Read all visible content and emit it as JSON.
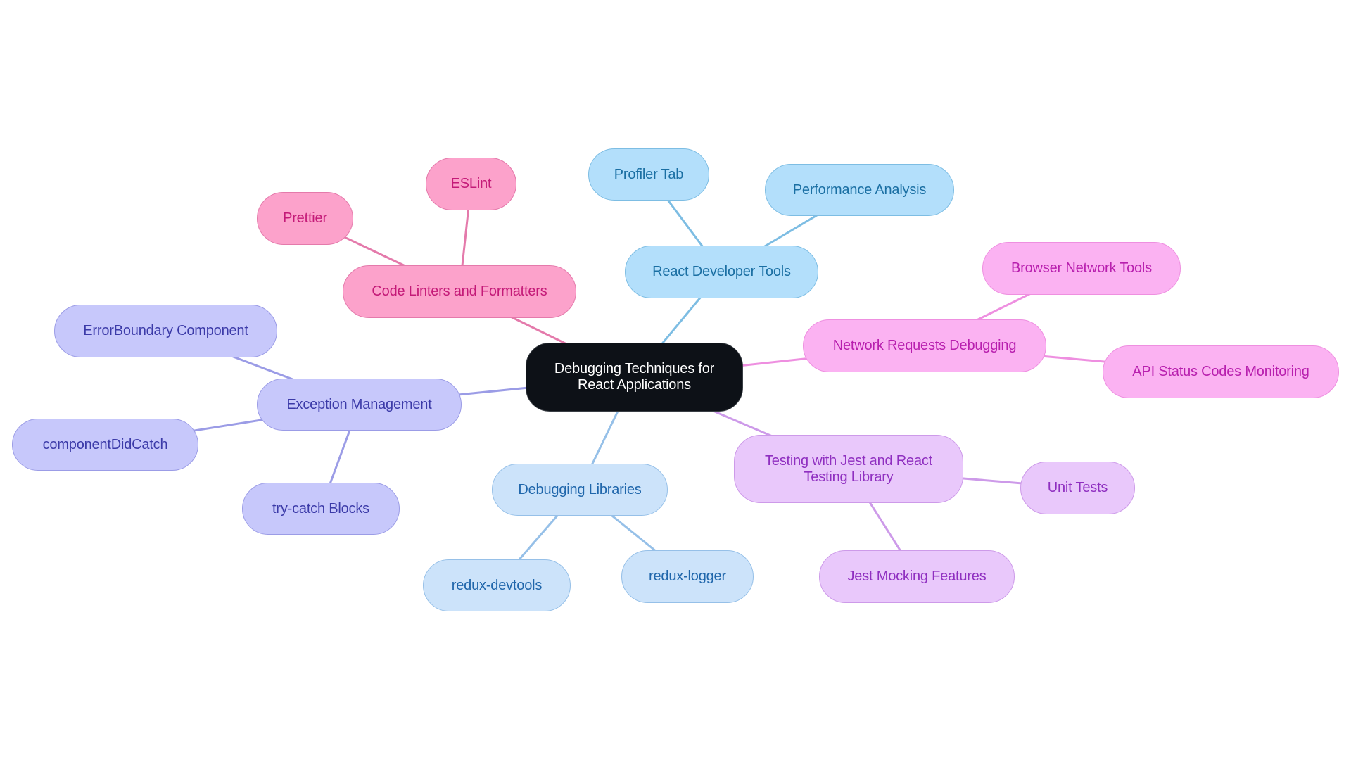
{
  "diagram": {
    "type": "mindmap",
    "root": {
      "id": "root",
      "label": "Debugging Techniques for\nReact Applications",
      "color": "#0d1117"
    },
    "branches": [
      {
        "id": "react-devtools",
        "label": "React Developer Tools",
        "theme": "blue",
        "edge_color": "#7dbde3",
        "children": [
          {
            "id": "profiler-tab",
            "label": "Profiler Tab"
          },
          {
            "id": "performance-analysis",
            "label": "Performance Analysis"
          }
        ]
      },
      {
        "id": "code-linters",
        "label": "Code Linters and Formatters",
        "theme": "pink",
        "edge_color": "#e47aab",
        "children": [
          {
            "id": "eslint",
            "label": "ESLint"
          },
          {
            "id": "prettier",
            "label": "Prettier"
          }
        ]
      },
      {
        "id": "exception-management",
        "label": "Exception Management",
        "theme": "indigo",
        "edge_color": "#9b9ce6",
        "children": [
          {
            "id": "errorboundary",
            "label": "ErrorBoundary Component"
          },
          {
            "id": "componentdidcatch",
            "label": "componentDidCatch"
          },
          {
            "id": "try-catch",
            "label": "try-catch Blocks"
          }
        ]
      },
      {
        "id": "debugging-libraries",
        "label": "Debugging Libraries",
        "theme": "sky",
        "edge_color": "#96c0e8",
        "children": [
          {
            "id": "redux-devtools",
            "label": "redux-devtools"
          },
          {
            "id": "redux-logger",
            "label": "redux-logger"
          }
        ]
      },
      {
        "id": "testing-jest",
        "label": "Testing with Jest and React\nTesting Library",
        "theme": "violet",
        "edge_color": "#cd9ae9",
        "children": [
          {
            "id": "unit-tests",
            "label": "Unit Tests"
          },
          {
            "id": "jest-mocking",
            "label": "Jest Mocking Features"
          }
        ]
      },
      {
        "id": "network-requests",
        "label": "Network Requests Debugging",
        "theme": "magenta",
        "edge_color": "#ee8fe0",
        "children": [
          {
            "id": "browser-network-tools",
            "label": "Browser Network Tools"
          },
          {
            "id": "api-status-codes",
            "label": "API Status Codes Monitoring"
          }
        ]
      }
    ]
  }
}
